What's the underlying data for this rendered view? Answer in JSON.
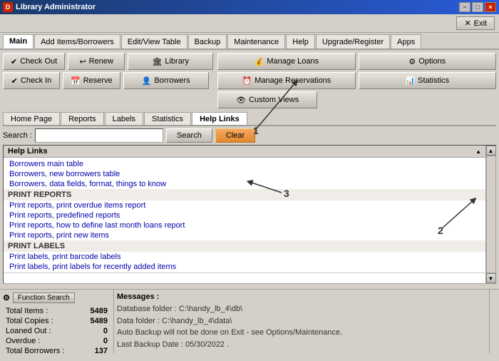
{
  "titleBar": {
    "icon": "D",
    "title": "Library Administrator",
    "minBtn": "−",
    "maxBtn": "□",
    "closeBtn": "×"
  },
  "exitButton": {
    "label": "Exit",
    "icon": "✕"
  },
  "menuTabs": [
    {
      "label": "Main",
      "active": true
    },
    {
      "label": "Add Items/Borrowers",
      "active": false
    },
    {
      "label": "Edit/View Table",
      "active": false
    },
    {
      "label": "Backup",
      "active": false
    },
    {
      "label": "Maintenance",
      "active": false
    },
    {
      "label": "Help",
      "active": false
    },
    {
      "label": "Upgrade/Register",
      "active": false
    },
    {
      "label": "Apps",
      "active": false
    }
  ],
  "leftButtons": {
    "row1": {
      "checkOut": "✔ Check Out",
      "renew": "↩ Renew",
      "library": "🏛 Library"
    },
    "row2": {
      "checkIn": "✔ Check In",
      "reserve": "📅 Reserve",
      "borrowers": "👤 Borrowers"
    }
  },
  "rightButtons": {
    "row1": {
      "manageLoans": "💰 Manage Loans",
      "options": "⚙ Options"
    },
    "row2": {
      "manageReservations": "⏰ Manage Reservations",
      "statistics": "📊 Statistics"
    },
    "row3": {
      "customViews": "👁 Custom Views"
    }
  },
  "secondaryTabs": [
    {
      "label": "Home Page",
      "active": false
    },
    {
      "label": "Reports",
      "active": false
    },
    {
      "label": "Labels",
      "active": false
    },
    {
      "label": "Statistics",
      "active": false
    },
    {
      "label": "Help Links",
      "active": true
    }
  ],
  "searchBar": {
    "label": "Search :",
    "placeholder": "",
    "searchBtn": "Search",
    "clearBtn": "Clear"
  },
  "helpLinksHeader": "Help Links",
  "helpItems": [
    {
      "type": "item",
      "text": "Borrowers main table"
    },
    {
      "type": "item",
      "text": "Borrowers, new borrowers table"
    },
    {
      "type": "item",
      "text": "Borrowers, data fields, format, things to know"
    },
    {
      "type": "section",
      "text": "PRINT REPORTS"
    },
    {
      "type": "item",
      "text": "Print reports, print overdue items report"
    },
    {
      "type": "item",
      "text": "Print reports, predefined reports"
    },
    {
      "type": "item",
      "text": "Print reports, how to define last month loans report"
    },
    {
      "type": "item",
      "text": "Print reports, print new items"
    },
    {
      "type": "section",
      "text": "PRINT LABELS"
    },
    {
      "type": "item",
      "text": "Print labels, print barcode labels"
    },
    {
      "type": "item",
      "text": "Print labels, print labels for recently added items"
    }
  ],
  "statusBar": {
    "funcSearchLabel": "Function Search",
    "messagesLabel": "Messages :",
    "stats": {
      "totalItems": {
        "label": "Total Items :",
        "value": "5489"
      },
      "totalCopies": {
        "label": "Total Copies :",
        "value": "5489"
      },
      "loanedOut": {
        "label": "Loaned Out :",
        "value": "0"
      },
      "overdue": {
        "label": "Overdue :",
        "value": "0"
      },
      "totalBorrowers": {
        "label": "Total Borrowers :",
        "value": "137"
      }
    },
    "messages": [
      "Database folder : C:\\handy_lb_4\\db\\",
      "Data folder : C:\\handy_lb_4\\data\\",
      "Auto Backup will not be done on Exit - see Options/Maintenance.",
      "Last Backup Date : 05/30/2022 ."
    ]
  },
  "annotations": {
    "one": "1",
    "two": "2",
    "three": "3"
  }
}
